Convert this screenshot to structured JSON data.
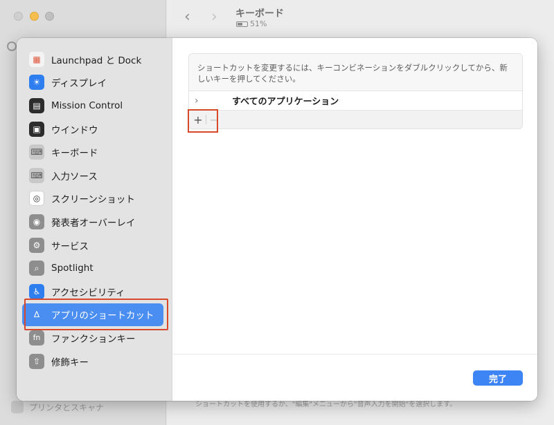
{
  "background": {
    "title": "キーボード",
    "battery": "51%",
    "footer_item": "プリンタとスキャナ",
    "footer_text": "ショートカットを使用するか、\"編集\"メニューから\"音声入力を開始\"を選択します。"
  },
  "sidebar": {
    "items": [
      {
        "label": "Launchpad と Dock",
        "icon": "launchpad-icon",
        "color": "#f4f4f4"
      },
      {
        "label": "ディスプレイ",
        "icon": "display-icon",
        "color": "#2f7ef0"
      },
      {
        "label": "Mission Control",
        "icon": "mission-control-icon",
        "color": "#2c2c2c"
      },
      {
        "label": "ウインドウ",
        "icon": "window-icon",
        "color": "#2c2c2c"
      },
      {
        "label": "キーボード",
        "icon": "keyboard-icon",
        "color": "#c8c8c8"
      },
      {
        "label": "入力ソース",
        "icon": "input-source-icon",
        "color": "#c8c8c8"
      },
      {
        "label": "スクリーンショット",
        "icon": "screenshot-icon",
        "color": "#ffffff"
      },
      {
        "label": "発表者オーバーレイ",
        "icon": "presenter-icon",
        "color": "#8e8e8e"
      },
      {
        "label": "サービス",
        "icon": "gear-icon",
        "color": "#8e8e8e"
      },
      {
        "label": "Spotlight",
        "icon": "spotlight-icon",
        "color": "#8e8e8e"
      },
      {
        "label": "アクセシビリティ",
        "icon": "accessibility-icon",
        "color": "#2f7ef0"
      },
      {
        "label": "アプリのショートカット",
        "icon": "app-store-icon",
        "color": "#4b8ef2"
      },
      {
        "label": "ファンクションキー",
        "icon": "fn-icon",
        "color": "#8e8e8e"
      },
      {
        "label": "修飾キー",
        "icon": "modifier-icon",
        "color": "#8e8e8e"
      }
    ],
    "selected_index": 11
  },
  "main": {
    "description": "ショートカットを変更するには、キーコンビネーションをダブルクリックしてから、新しいキーを押してください。",
    "row_label": "すべてのアプリケーション",
    "add_symbol": "+",
    "remove_symbol": "−",
    "done_label": "完了"
  }
}
